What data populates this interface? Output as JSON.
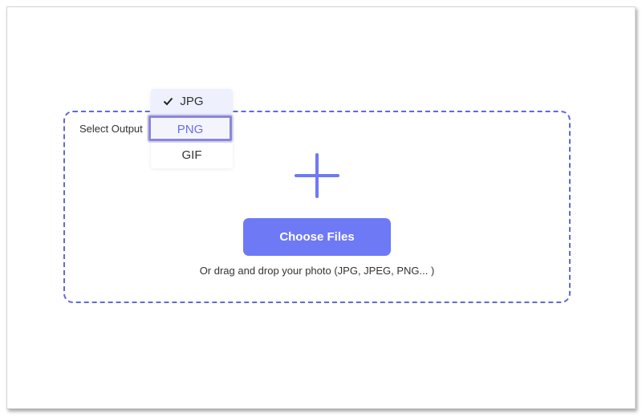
{
  "uploader": {
    "select_output_label": "Select Output",
    "formats": [
      {
        "label": "JPG",
        "checked": true
      },
      {
        "label": "PNG",
        "highlighted": true
      },
      {
        "label": "GIF"
      }
    ],
    "add_icon": "plus-icon",
    "check_icon": "checkmark-icon",
    "choose_button_label": "Choose Files",
    "drag_hint": "Or drag and drop your photo (JPG, JPEG, PNG... )"
  },
  "colors": {
    "accent": "#6e79f6",
    "dash_border": "#6068d8",
    "highlight_border": "#8a87d6",
    "selected_bg": "#eef0fd",
    "text": "#333333"
  }
}
